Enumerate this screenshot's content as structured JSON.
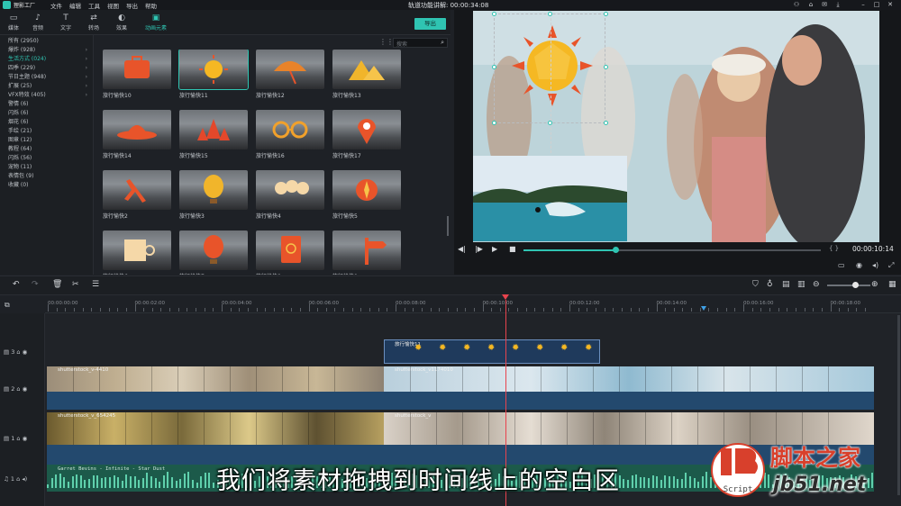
{
  "menubar": {
    "app_name": "狸影工厂",
    "items": [
      "文件",
      "编辑",
      "工具",
      "视图",
      "导出",
      "帮助"
    ],
    "title": "轨道功能讲解: 00:00:34:08"
  },
  "library_tabs": [
    {
      "label": "媒体",
      "icon": "folder-icon"
    },
    {
      "label": "音频",
      "icon": "music-note-icon"
    },
    {
      "label": "文字",
      "icon": "text-icon"
    },
    {
      "label": "转场",
      "icon": "transition-icon"
    },
    {
      "label": "效果",
      "icon": "effects-icon"
    },
    {
      "label": "动画元素",
      "icon": "elements-icon"
    }
  ],
  "export_label": "导出",
  "categories": [
    {
      "label": "所有 (2950)"
    },
    {
      "label": "爆炸 (928)"
    },
    {
      "label": "生活方式 (024)",
      "active": true
    },
    {
      "label": "四季 (229)"
    },
    {
      "label": "节日主题 (948)"
    },
    {
      "label": "扩展 (25)"
    },
    {
      "label": "VFX特效 (405)"
    },
    {
      "label": "警情 (6)"
    },
    {
      "label": "闪烁 (6)"
    },
    {
      "label": "烟花 (6)"
    },
    {
      "label": "手绘 (21)"
    },
    {
      "label": "图章 (12)"
    },
    {
      "label": "教程 (64)"
    },
    {
      "label": "闪烁 (56)"
    },
    {
      "label": "宠物 (11)"
    },
    {
      "label": "表情包 (9)"
    },
    {
      "label": "收藏 (0)"
    }
  ],
  "search": {
    "placeholder": "搜索"
  },
  "elements": [
    {
      "label": "旅行愉快10",
      "icon": "suitcase-icon",
      "color": "#e8542a"
    },
    {
      "label": "旅行愉快11",
      "icon": "sun-icon",
      "color": "#f5b823",
      "selected": true
    },
    {
      "label": "旅行愉快12",
      "icon": "umbrella-icon",
      "color": "#e8832a"
    },
    {
      "label": "旅行愉快13",
      "icon": "mountain-icon",
      "color": "#f1b52b"
    },
    {
      "label": "旅行愉快14",
      "icon": "hat-icon",
      "color": "#e8542a"
    },
    {
      "label": "旅行愉快15",
      "icon": "tree-icon",
      "color": "#e4482b"
    },
    {
      "label": "旅行愉快16",
      "icon": "sunglasses-icon",
      "color": "#f1a12b"
    },
    {
      "label": "旅行愉快17",
      "icon": "pin-icon",
      "color": "#e8542a"
    },
    {
      "label": "旅行愉快2",
      "icon": "plane-icon",
      "color": "#e8542a"
    },
    {
      "label": "旅行愉快3",
      "icon": "balloon-icon",
      "color": "#f1b52b"
    },
    {
      "label": "旅行愉快4",
      "icon": "ice-cream-icon",
      "color": "#f5d8a8"
    },
    {
      "label": "旅行愉快5",
      "icon": "compass-icon",
      "color": "#e8542a"
    },
    {
      "label": "旅行愉快6",
      "icon": "cup-icon",
      "color": "#f5d8a8"
    },
    {
      "label": "旅行愉快7",
      "icon": "balloon-icon",
      "color": "#e8542a"
    },
    {
      "label": "旅行愉快8",
      "icon": "passport-icon",
      "color": "#e8542a"
    },
    {
      "label": "旅行愉快9",
      "icon": "signpost-icon",
      "color": "#e8542a"
    }
  ],
  "player": {
    "timecode": "00:00:10:14",
    "progress": 0.31
  },
  "ruler_labels": [
    "00:00:00:00",
    "00:00:02:00",
    "00:00:04:00",
    "00:00:06:00",
    "00:00:08:00",
    "00:00:10:00",
    "00:00:12:00",
    "00:00:14:00",
    "00:00:16:00",
    "00:00:18:00"
  ],
  "tracks": [
    {
      "label": "3",
      "kind": "video"
    },
    {
      "label": "2",
      "kind": "video"
    },
    {
      "label": "1",
      "kind": "video"
    },
    {
      "label": "1",
      "kind": "audio"
    }
  ],
  "clips": {
    "sticker": "旅行愉快11",
    "v2a": "shutterstock_v-4410",
    "v2b": "shutterstock_v1174010",
    "v1a": "shutterstock_v_654245",
    "v1b": "shutterstock_v",
    "audio": "Garret Bevins - Infinite - Star Dust"
  },
  "caption": "我们将素材拖拽到时间线上的空白区",
  "watermark": {
    "logo_text": "Script",
    "site_name": "脚本之家",
    "url": "jb51.net"
  }
}
